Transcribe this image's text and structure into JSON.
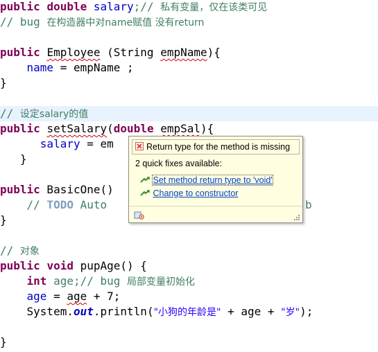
{
  "code": {
    "l1": {
      "kw1": "public",
      "kw2": "double",
      "name": "salary",
      "rest": ";// ",
      "comment": "私有变量，仅在该类可见"
    },
    "l2": {
      "comment_prefix": "// bug ",
      "comment": "在构造器中对name赋值 没有return"
    },
    "l4": {
      "kw": "public",
      "rest1": " ",
      "ctor": "Employee",
      "rest2": " (String ",
      "param": "empName",
      "rest3": "){"
    },
    "l5": {
      "indent": "    ",
      "field": "name",
      "rest": " = empName ;"
    },
    "l6": {
      "text": "}"
    },
    "l8": {
      "comment_prefix": "// ",
      "comment": "设定salary的值"
    },
    "l9": {
      "kw": "public",
      "rest1": " ",
      "method": "setSalary",
      "rest2": "(",
      "kw2": "double",
      "rest3": " ",
      "param": "empSal",
      "rest4": "){"
    },
    "l10": {
      "indent": "      ",
      "field": "salary",
      "rest": " = em"
    },
    "l11": {
      "text": "   }"
    },
    "l13": {
      "kw": "public",
      "rest": " BasicOne()"
    },
    "l14": {
      "indent": "    ",
      "comment_prefix": "// ",
      "todo": "TODO",
      "rest": " Auto"
    },
    "l14_tail": "b",
    "l15": {
      "text": "}"
    },
    "l17": {
      "comment_prefix": "// ",
      "comment": "对象"
    },
    "l18": {
      "kw1": "public",
      "kw2": "void",
      "rest": " pupAge() {"
    },
    "l19": {
      "indent": "    ",
      "kw": "int",
      "rest": " age;// bug ",
      "comment": "局部变量初始化"
    },
    "l20": {
      "indent": "    ",
      "var": "age",
      "rest1": " = ",
      "var2": "age",
      "rest2": " + 7;"
    },
    "l21": {
      "indent": "    ",
      "pre": "System.",
      "sfield": "out",
      "mid": ".println(",
      "str1": "\"小狗的年龄是\"",
      "mid2": " + age + ",
      "str2": "\"岁\"",
      "end": ");"
    },
    "l23": {
      "text": "}"
    }
  },
  "quickfix": {
    "title": "Return type for the method is missing",
    "subtitle": "2 quick fixes available:",
    "fixes": [
      {
        "label": "Set method return type to 'void'"
      },
      {
        "label": "Change to constructor"
      }
    ]
  },
  "colors": {
    "keyword": "#7f0055",
    "comment": "#3f7f5f",
    "field": "#0000c0",
    "string": "#2a00ff",
    "highlight_line": "#e8f2fe",
    "popup_bg": "#fffee1"
  },
  "icons": [
    "error-icon",
    "quickfix-bulb-icon",
    "settings-icon",
    "resize-grip-icon"
  ]
}
